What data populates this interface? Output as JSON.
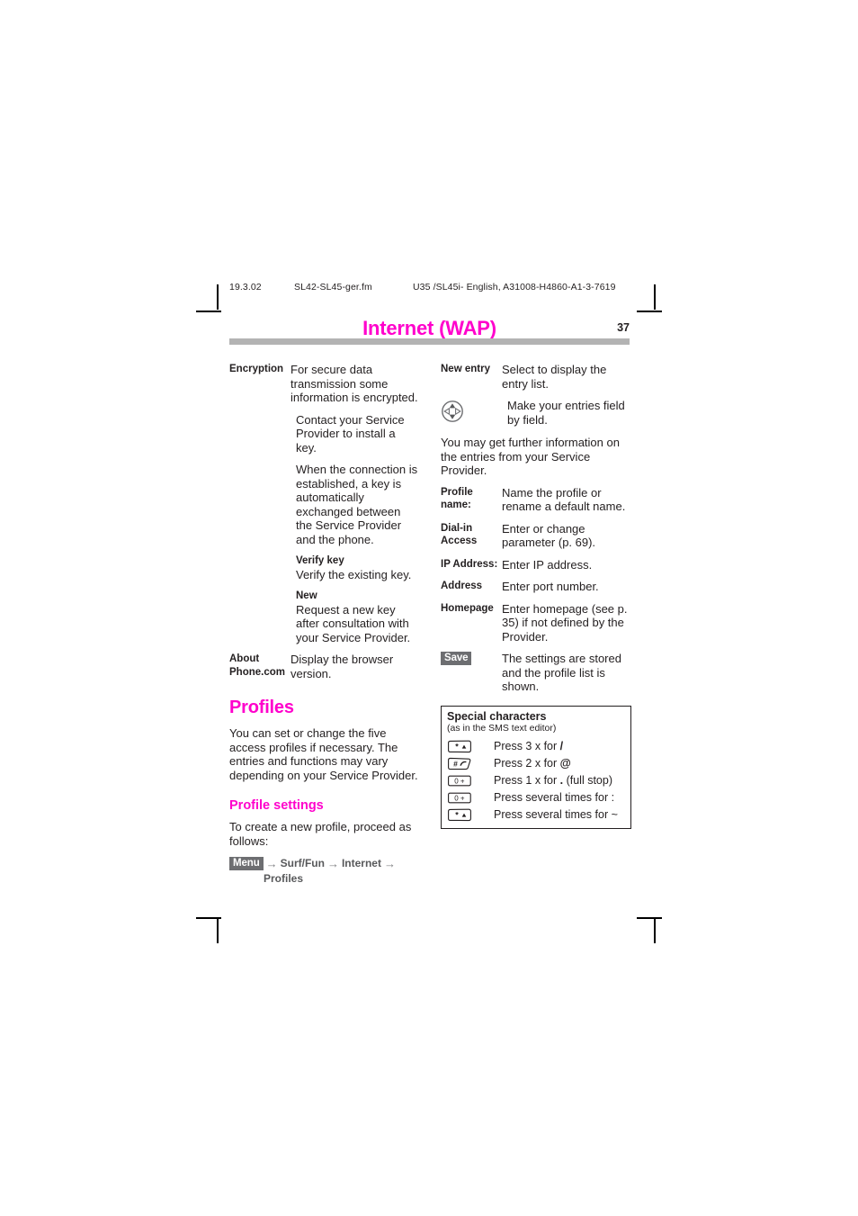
{
  "running_header": {
    "date": "19.3.02",
    "filename": "SL42-SL45-ger.fm",
    "doc_id": "U35 /SL45i- English, A31008-H4860-A1-3-7619"
  },
  "header": {
    "chapter_title": "Internet (WAP)",
    "page_number": "37",
    "accent_color": "#ff00cc",
    "rule_color": "#b3b3b3"
  },
  "left_column": {
    "encryption": {
      "term": "Encryption",
      "paragraphs": [
        "For secure data transmission some information is encrypted.",
        "Contact your Service Provider to install a key.",
        "When the connection is established, a key is automatically exchanged between the Service Provider and the phone."
      ],
      "verify_key": {
        "term": "Verify key",
        "text": "Verify the existing key."
      },
      "new_key": {
        "term": "New",
        "text": "Request a new key after consultation with your Service Provider."
      }
    },
    "about": {
      "term_line1": "About",
      "term_line2": "Phone.com",
      "text": "Display the browser version."
    },
    "profiles_heading": "Profiles",
    "profiles_intro": "You can set or change the five access profiles if necessary. The entries and functions may vary depending on your Service Provider.",
    "profile_settings_heading": "Profile settings",
    "profile_settings_intro": "To create a new profile, proceed as follows:",
    "menu_path": {
      "softkey": "Menu",
      "arrow": "→",
      "step1": "Surf/Fun",
      "step2": "Internet",
      "step3": "Profiles"
    }
  },
  "right_column": {
    "new_entry": {
      "term": "New entry",
      "text": "Select to display the entry list."
    },
    "nav_key": {
      "icon": "navigation-key-icon",
      "text": "Make your entries field by field."
    },
    "info_paragraph": "You may get further information on the entries from your Service Provider.",
    "settings": [
      {
        "term": "Profile name:",
        "text": "Name the profile or rename a default name."
      },
      {
        "term": "Dial-in Access",
        "text": "Enter or change parameter (p. 69)."
      },
      {
        "term": "IP Address:",
        "text": "Enter IP address."
      },
      {
        "term": "Address",
        "text": "Enter port number."
      },
      {
        "term": "Homepage",
        "text": "Enter homepage (see p. 35)  if not defined by the Provider."
      }
    ],
    "save": {
      "softkey": "Save",
      "text": "The settings are stored and the profile list is shown."
    },
    "special_characters": {
      "title": "Special characters",
      "subtitle": "(as in the SMS text editor)",
      "rows": [
        {
          "key": "star-key-icon",
          "key_label": "*",
          "text_before": "Press 3 x for ",
          "char": "/",
          "text_after": ""
        },
        {
          "key": "hash-key-icon",
          "key_label": "#",
          "text_before": "Press 2 x for ",
          "char": "@",
          "text_after": ""
        },
        {
          "key": "zero-key-icon",
          "key_label": "0 +",
          "text_before": "Press 1 x for ",
          "char": ".",
          "text_after": " (full stop)"
        },
        {
          "key": "zero-key-icon",
          "key_label": "0 +",
          "text_before": "Press several times for ",
          "char": ":",
          "text_after": ""
        },
        {
          "key": "star-key-icon",
          "key_label": "*",
          "text_before": "Press several times for ",
          "char": "~",
          "text_after": ""
        }
      ]
    }
  }
}
